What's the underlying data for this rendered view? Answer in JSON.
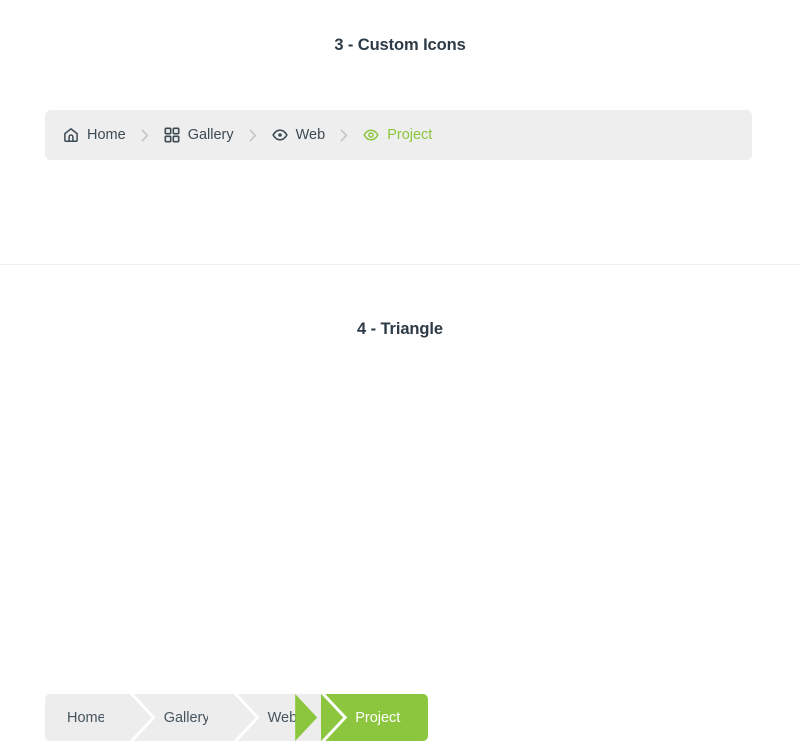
{
  "sections": [
    {
      "id": "custom-icons",
      "title": "3 - Custom Icons",
      "breadcrumb": {
        "separator": "chevron-right-icon",
        "items": [
          {
            "label": "Home",
            "icon": "home-icon",
            "active": false
          },
          {
            "label": "Gallery",
            "icon": "grid-icon",
            "active": false
          },
          {
            "label": "Web",
            "icon": "eye-icon",
            "active": false
          },
          {
            "label": "Project",
            "icon": "eye-icon",
            "active": true
          }
        ]
      }
    },
    {
      "id": "triangle",
      "title": "4 - Triangle",
      "breadcrumb": {
        "items": [
          {
            "label": "Home",
            "active": false
          },
          {
            "label": "Gallery",
            "active": false
          },
          {
            "label": "Web",
            "active": false
          },
          {
            "label": "Project",
            "active": true
          }
        ]
      }
    }
  ],
  "colors": {
    "accent": "#8cc63e",
    "panel": "#eeeeee",
    "segment": "#ededed",
    "text": "#3c4a54",
    "title": "#2e3b47",
    "separator": "#c3c8cc",
    "divider": "#ececec",
    "background": "#ffffff"
  }
}
